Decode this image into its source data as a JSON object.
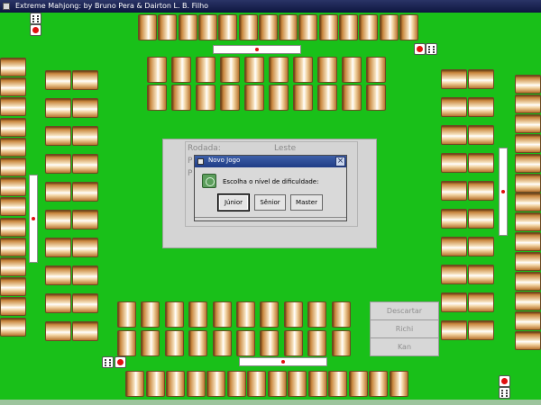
{
  "window": {
    "title": "Extreme Mahjong: by Bruno Pera & Dairton L. B. Filho"
  },
  "game": {
    "round_label": "Rodada:",
    "round_value": "Leste",
    "hidden_label_1": "P",
    "hidden_label_2": "P"
  },
  "dialog": {
    "title": "Novo Jogo",
    "close_glyph": "×",
    "message": "Escolha o nível de dificuldade:",
    "buttons": {
      "junior": "Júnior",
      "senior": "Sênior",
      "master": "Master"
    }
  },
  "actions": {
    "discard": "Descartar",
    "richi": "Richi",
    "kan": "Kan"
  },
  "colors": {
    "table": "#19c019",
    "wind_marker": "#e01010",
    "dialog_title": "#2b4a96"
  }
}
